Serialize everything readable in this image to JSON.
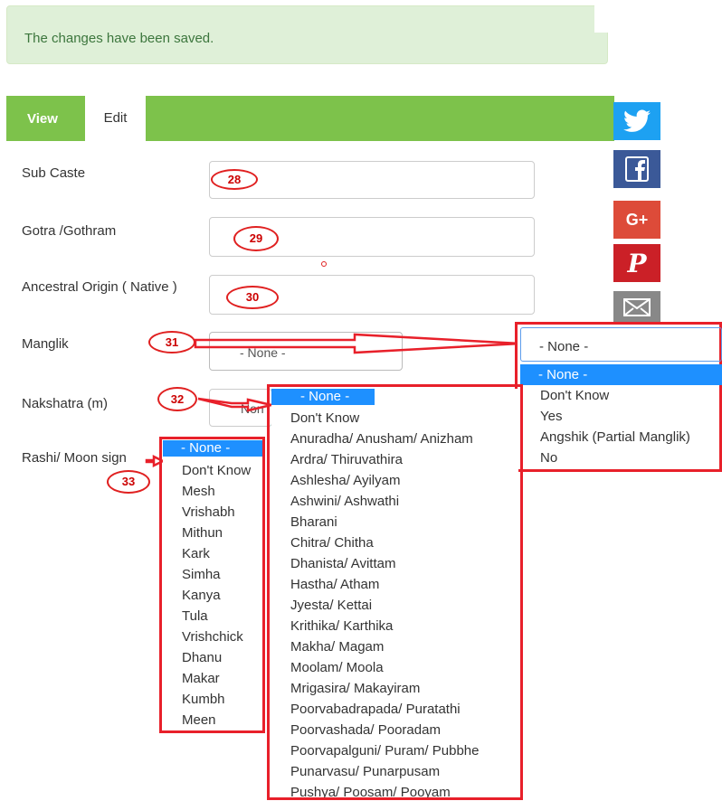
{
  "alert": {
    "message": "The changes have been saved."
  },
  "tabs": {
    "view": "View",
    "edit": "Edit"
  },
  "social": {
    "twitter_icon": "twitter-icon",
    "facebook_icon": "facebook-icon",
    "gplus_label": "G+",
    "pinterest_label": "P",
    "mail_icon": "mail-icon"
  },
  "fields": {
    "sub_caste_label": "Sub Caste",
    "gotra_label": "Gotra /Gothram",
    "ancestral_label": "Ancestral Origin ( Native )",
    "manglik_label": "Manglik",
    "nakshatra_label": "Nakshatra (m)",
    "rashi_label": "Rashi/ Moon sign"
  },
  "manglik_select": {
    "value": "- None -"
  },
  "nakshatra_select": {
    "value": "Non"
  },
  "annotations": [
    "28",
    "29",
    "30",
    "31",
    "32",
    "33"
  ],
  "manglik_dropdown": {
    "selected": "- None -",
    "options": [
      "- None -",
      "Don't Know",
      "Yes",
      "Angshik (Partial Manglik)",
      "No"
    ]
  },
  "nakshatra_dropdown": {
    "options": [
      "- None -",
      "Don't Know",
      "Anuradha/ Anusham/ Anizham",
      "Ardra/ Thiruvathira",
      "Ashlesha/ Ayilyam",
      "Ashwini/ Ashwathi",
      "Bharani",
      "Chitra/ Chitha",
      "Dhanista/ Avittam",
      "Hastha/ Atham",
      "Jyesta/ Kettai",
      "Krithika/ Karthika",
      "Makha/ Magam",
      "Moolam/ Moola",
      "Mrigasira/ Makayiram",
      "Poorvabadrapada/ Puratathi",
      "Poorvashada/ Pooradam",
      "Poorvapalguni/ Puram/ Pubbhe",
      "Punarvasu/ Punarpusam",
      "Pushya/ Poosam/ Pooyam"
    ]
  },
  "rashi_dropdown": {
    "options": [
      "- None -",
      "Don't Know",
      "Mesh",
      "Vrishabh",
      "Mithun",
      "Kark",
      "Simha",
      "Kanya",
      "Tula",
      "Vrishchick",
      "Dhanu",
      "Makar",
      "Kumbh",
      "Meen"
    ]
  },
  "colors": {
    "tab_bar": "#7dc24b",
    "alert_bg": "#dff0d8",
    "alert_text": "#3c763d",
    "highlight": "#1e90ff",
    "annotation_red": "#e8202a",
    "twitter": "#1da1f2",
    "facebook": "#3b5998",
    "gplus": "#dd4b39",
    "pinterest": "#cb2027",
    "mail": "#888888"
  }
}
